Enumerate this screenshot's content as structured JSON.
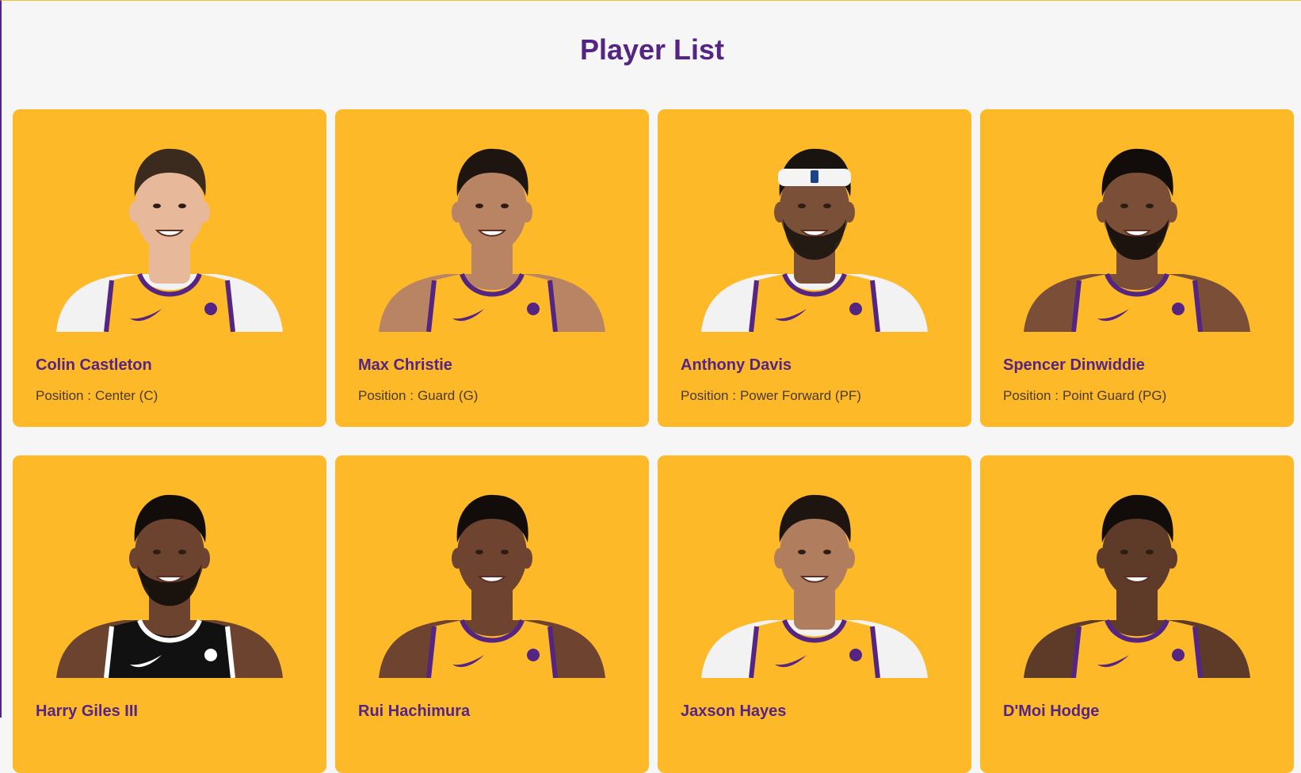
{
  "page": {
    "title": "Player List",
    "position_prefix": "Position :"
  },
  "colors": {
    "background": "#f6f6f6",
    "card": "#fdb927",
    "title": "#552583",
    "jersey_lakers": "#fdb927",
    "jersey_trim": "#552583",
    "jersey_nets": "#111111"
  },
  "players": [
    {
      "name": "Colin Castleton",
      "position": "Center (C)",
      "skin": "#e7b99a",
      "hair": "#3b2a1e",
      "jersey": "lakers",
      "undershirt": true,
      "headband": false,
      "beard": false
    },
    {
      "name": "Max Christie",
      "position": "Guard (G)",
      "skin": "#b98463",
      "hair": "#1e1510",
      "jersey": "lakers",
      "undershirt": false,
      "headband": false,
      "beard": false
    },
    {
      "name": "Anthony Davis",
      "position": "Power Forward (PF)",
      "skin": "#7b5038",
      "hair": "#1a1410",
      "jersey": "lakers",
      "undershirt": true,
      "headband": true,
      "beard": true
    },
    {
      "name": "Spencer Dinwiddie",
      "position": "Point Guard (PG)",
      "skin": "#7a4e37",
      "hair": "#120d0a",
      "jersey": "lakers",
      "undershirt": false,
      "headband": false,
      "beard": true
    },
    {
      "name": "Harry Giles III",
      "position": "",
      "skin": "#6b432e",
      "hair": "#120d0a",
      "jersey": "nets",
      "undershirt": false,
      "headband": false,
      "beard": true
    },
    {
      "name": "Rui Hachimura",
      "position": "",
      "skin": "#6e4330",
      "hair": "#120d0a",
      "jersey": "lakers",
      "undershirt": false,
      "headband": false,
      "beard": false
    },
    {
      "name": "Jaxson Hayes",
      "position": "",
      "skin": "#b07e5f",
      "hair": "#1e1510",
      "jersey": "lakers",
      "undershirt": true,
      "headband": false,
      "beard": false
    },
    {
      "name": "D'Moi Hodge",
      "position": "",
      "skin": "#5e3a28",
      "hair": "#120d0a",
      "jersey": "lakers",
      "undershirt": false,
      "headband": false,
      "beard": false
    }
  ]
}
